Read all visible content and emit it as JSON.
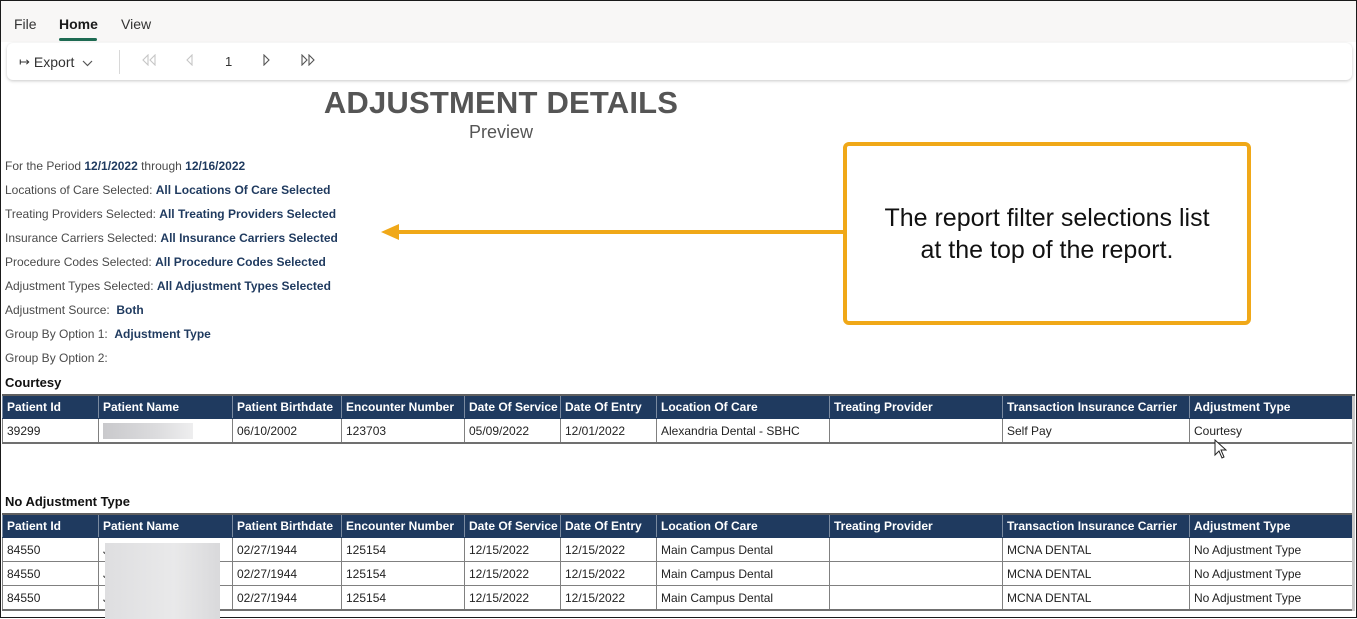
{
  "menu": {
    "items": [
      {
        "label": "File"
      },
      {
        "label": "Home",
        "active": true
      },
      {
        "label": "View"
      }
    ]
  },
  "toolbar": {
    "export_label": "Export",
    "export_icon": "export-arrow-icon",
    "current_page": "1",
    "nav_icons": [
      "first-page-icon",
      "previous-page-icon",
      "next-page-icon",
      "last-page-icon"
    ]
  },
  "report": {
    "title": "ADJUSTMENT DETAILS",
    "subtitle": "Preview",
    "period": {
      "prefix": "For the Period ",
      "start": "12/1/2022",
      "middle": " through ",
      "end": "12/16/2022"
    },
    "filters": [
      {
        "label": "Locations of Care Selected: ",
        "value": "All Locations Of Care Selected"
      },
      {
        "label": "Treating Providers Selected: ",
        "value": "All Treating Providers Selected"
      },
      {
        "label": "Insurance Carriers Selected: ",
        "value": "All Insurance Carriers Selected"
      },
      {
        "label": "Procedure Codes Selected: ",
        "value": "All Procedure Codes Selected"
      },
      {
        "label": "Adjustment Types Selected: ",
        "value": "All Adjustment Types Selected"
      },
      {
        "label": "Adjustment Source:  ",
        "value": "Both"
      },
      {
        "label": "Group By Option 1:  ",
        "value": "Adjustment Type"
      },
      {
        "label": "Group By Option 2: ",
        "value": ""
      }
    ],
    "columns": [
      "Patient Id",
      "Patient Name",
      "Patient Birthdate",
      "Encounter Number",
      "Date Of Service",
      "Date Of Entry",
      "Location Of Care",
      "Treating Provider",
      "Transaction Insurance Carrier",
      "Adjustment Type"
    ],
    "groups": [
      {
        "title": "Courtesy",
        "rows": [
          [
            "39299",
            "",
            "06/10/2002",
            "123703",
            "05/09/2022",
            "12/01/2022",
            "Alexandria Dental - SBHC",
            "",
            "Self Pay",
            "Courtesy"
          ]
        ]
      },
      {
        "title": "No Adjustment Type",
        "rows": [
          [
            "84550",
            "J",
            "02/27/1944",
            "125154",
            "12/15/2022",
            "12/15/2022",
            "Main Campus Dental",
            "",
            "MCNA DENTAL",
            "No Adjustment Type"
          ],
          [
            "84550",
            "J",
            "02/27/1944",
            "125154",
            "12/15/2022",
            "12/15/2022",
            "Main Campus Dental",
            "",
            "MCNA DENTAL",
            "No Adjustment Type"
          ],
          [
            "84550",
            "J",
            "02/27/1944",
            "125154",
            "12/15/2022",
            "12/15/2022",
            "Main Campus Dental",
            "",
            "MCNA DENTAL",
            "No Adjustment Type"
          ]
        ]
      }
    ]
  },
  "callout": {
    "line1": "The report filter selections list",
    "line2": "at the top of the report.",
    "color": "#f0a818"
  },
  "colors": {
    "header_bg": "#1f3a5f",
    "filter_value": "#1f3a5f",
    "active_tab_underline": "#1e6b52"
  }
}
